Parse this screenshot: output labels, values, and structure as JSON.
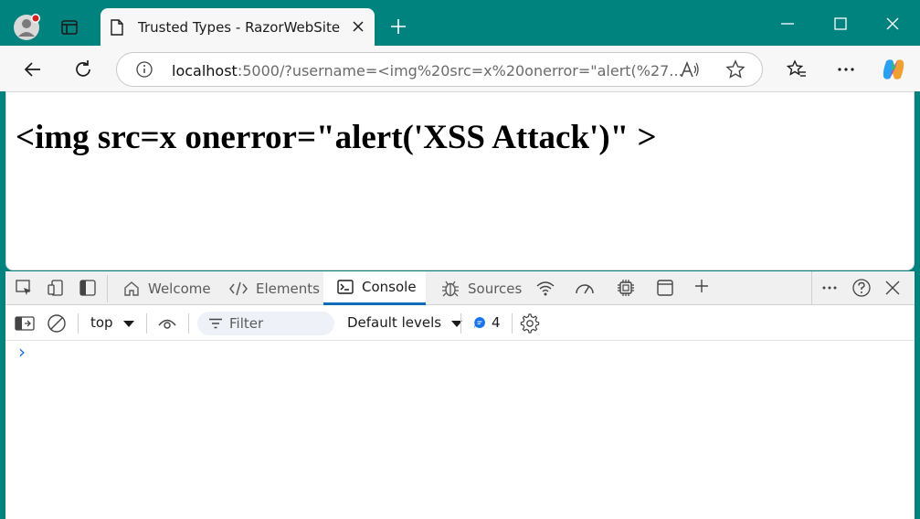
{
  "browser": {
    "tab_title": "Trusted Types - RazorWebSite",
    "url_host": "localhost",
    "url_rest": ":5000/?username=<img%20src=x%20onerror=\"alert(%27...",
    "accent_color": "#00827f"
  },
  "page": {
    "heading": "<img src=x onerror=\"alert('XSS Attack')\" >"
  },
  "devtools": {
    "tabs": [
      {
        "label": "Welcome"
      },
      {
        "label": "Elements"
      },
      {
        "label": "Console"
      },
      {
        "label": "Sources"
      }
    ],
    "active_tab": "Console",
    "context": "top",
    "filter_placeholder": "Filter",
    "levels": "Default levels",
    "message_count": "4",
    "prompt": "›"
  }
}
